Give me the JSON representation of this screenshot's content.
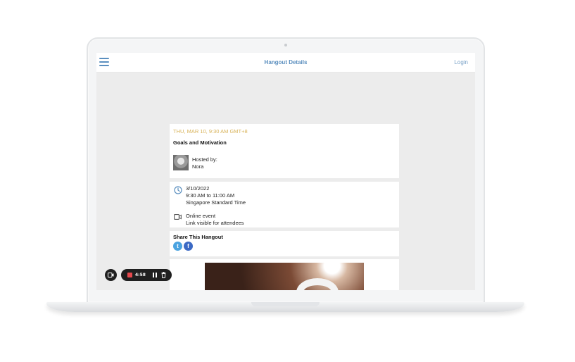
{
  "header": {
    "title": "Hangout Details",
    "login_label": "Login"
  },
  "event": {
    "date_line": "THU, MAR 10, 9:30 AM GMT+8",
    "title": "Goals and Motivation",
    "hosted_by_label": "Hosted by:",
    "host_name": "Nora"
  },
  "details": {
    "date": "3/10/2022",
    "time": "9:30 AM to 11:00 AM",
    "timezone": "Singapore Standard Time",
    "location_type": "Online event",
    "location_note": "Link visible for attendees"
  },
  "share": {
    "title": "Share This Hangout",
    "twitter_glyph": "t",
    "facebook_glyph": "f"
  },
  "recorder": {
    "time": "4:58"
  },
  "colors": {
    "accent": "#5b8fbf",
    "date_gold": "#d8b35a",
    "twitter": "#4aa3e0",
    "facebook": "#3b69c4",
    "record_red": "#e5484d"
  },
  "icons": [
    "menu-icon",
    "clock-icon",
    "video-camera-icon",
    "twitter-icon",
    "facebook-icon",
    "stop-icon",
    "pause-icon",
    "trash-icon"
  ]
}
